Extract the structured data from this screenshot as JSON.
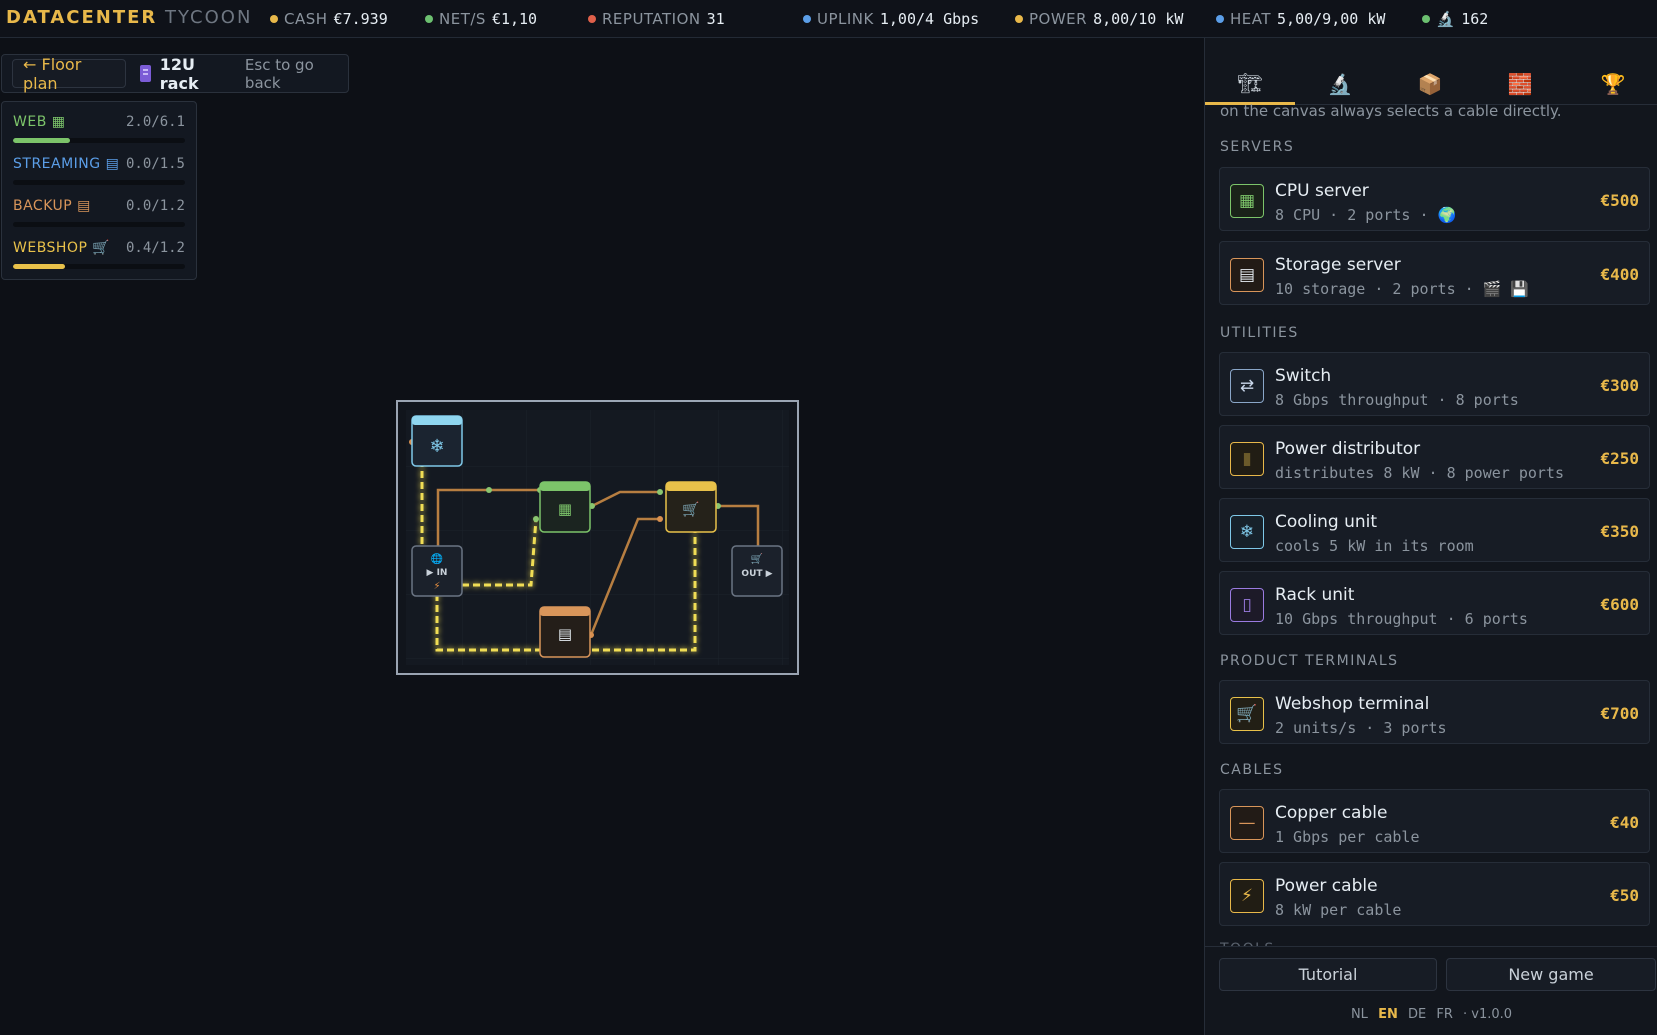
{
  "header": {
    "brand_primary": "DATACENTER",
    "brand_secondary": "TYCOON",
    "stats": [
      {
        "id": "cash",
        "label": "CASH",
        "value": "€7.939",
        "color": "#e8b84a"
      },
      {
        "id": "net",
        "label": "NET/S",
        "value": "€1,10",
        "color": "#6cc070"
      },
      {
        "id": "reputation",
        "label": "REPUTATION",
        "value": "31",
        "color": "#e0604a"
      },
      {
        "id": "uplink",
        "label": "UPLINK",
        "value": "1,00/4 Gbps",
        "color": "#5b9ee8"
      },
      {
        "id": "power",
        "label": "POWER",
        "value": "8,00/10 kW",
        "color": "#e8b84a"
      },
      {
        "id": "heat",
        "label": "HEAT",
        "value": "5,00/9,00 kW",
        "color": "#5b9ee8"
      },
      {
        "id": "research",
        "label": "🔬",
        "value": "162",
        "color": "#6cc070"
      }
    ]
  },
  "backbar": {
    "back_label": "← Floor plan",
    "rack_title": "12U rack",
    "hint": "Esc to go back"
  },
  "demand": [
    {
      "name": "WEB",
      "icon": "▦",
      "value": "2.0/6.1",
      "fill": 0.33,
      "color": "#7cc46a"
    },
    {
      "name": "STREAMING",
      "icon": "▤",
      "value": "0.0/1.5",
      "fill": 0.0,
      "color": "#5b9ee8"
    },
    {
      "name": "BACKUP",
      "icon": "▤",
      "value": "0.0/1.2",
      "fill": 0.0,
      "color": "#d8955a"
    },
    {
      "name": "WEBSHOP",
      "icon": "🛒",
      "value": "0.4/1.2",
      "fill": 0.3,
      "color": "#e8c14a"
    }
  ],
  "rack": {
    "in_label": "▶ IN",
    "out_label": "OUT ▶"
  },
  "sidebar": {
    "tabs": [
      {
        "name": "build",
        "icon": "🏗",
        "active": true
      },
      {
        "name": "research",
        "icon": "🔬",
        "active": false
      },
      {
        "name": "inventory",
        "icon": "📦",
        "active": false
      },
      {
        "name": "rooms",
        "icon": "🧱",
        "active": false
      },
      {
        "name": "achievements",
        "icon": "🏆",
        "active": false
      }
    ],
    "intro_text": "on the canvas always selects a cable directly.",
    "sections": {
      "servers": "SERVERS",
      "utilities": "UTILITIES",
      "terminals": "PRODUCT TERMINALS",
      "cables": "CABLES",
      "tools": "TOOLS"
    },
    "items": {
      "cpu": {
        "name": "CPU server",
        "desc": "8 CPU · 2 ports · 🌍",
        "price": "€500",
        "icon": "▦",
        "color": "#7cc46a"
      },
      "storage": {
        "name": "Storage server",
        "desc": "10 storage · 2 ports · 🎬 💾",
        "price": "€400",
        "icon": "▤",
        "color": "#d8955a"
      },
      "switch": {
        "name": "Switch",
        "desc": "8 Gbps throughput · 8 ports",
        "price": "€300",
        "icon": "⇄",
        "color": "#8aa6c8"
      },
      "pdu": {
        "name": "Power distributor",
        "desc": "distributes 8 kW · 8 power ports",
        "price": "€250",
        "icon": "▮",
        "color": "#e8b84a"
      },
      "cooling": {
        "name": "Cooling unit",
        "desc": "cools 5 kW in its room",
        "price": "€350",
        "icon": "❄",
        "color": "#7fc8e8"
      },
      "rackunit": {
        "name": "Rack unit",
        "desc": "10 Gbps throughput · 6 ports",
        "price": "€600",
        "icon": "▯",
        "color": "#9a7be0"
      },
      "webshop": {
        "name": "Webshop terminal",
        "desc": "2 units/s · 3 ports",
        "price": "€700",
        "icon": "🛒",
        "color": "#e8c14a"
      },
      "copper": {
        "name": "Copper cable",
        "desc": "1 Gbps per cable",
        "price": "€40",
        "icon": "—",
        "color": "#d8955a"
      },
      "powercable": {
        "name": "Power cable",
        "desc": "8 kW per cable",
        "price": "€50",
        "icon": "⚡",
        "color": "#e8b84a"
      }
    },
    "footer": {
      "tutorial": "Tutorial",
      "new_game": "New game",
      "langs": [
        "NL",
        "EN",
        "DE",
        "FR"
      ],
      "current_lang": "EN",
      "version": "· v1.0.0"
    }
  }
}
